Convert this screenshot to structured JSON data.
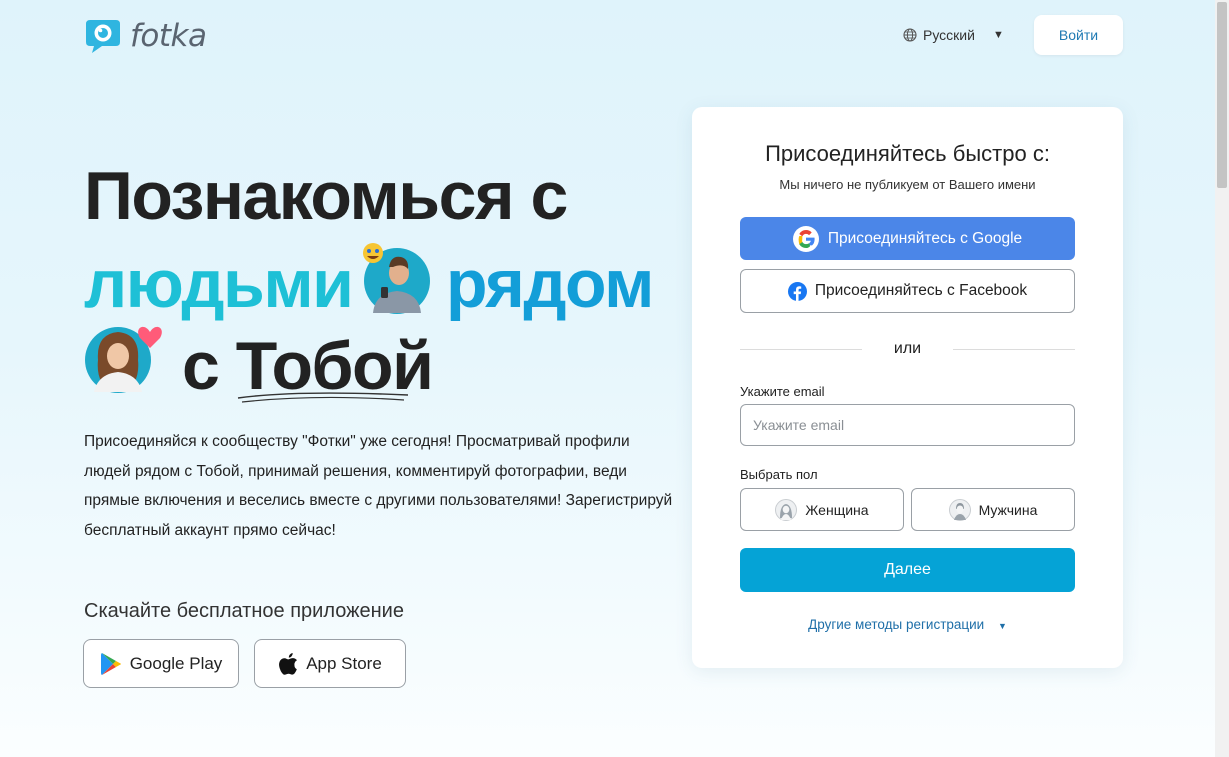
{
  "brand": {
    "name": "fotka",
    "accent": "#1fb5d6",
    "logo_color": "#2fb5e0"
  },
  "header": {
    "language": {
      "icon": "globe-icon",
      "label": "Русский",
      "caret": "▼"
    },
    "login_label": "Войти"
  },
  "hero": {
    "line1": "Познакомься с",
    "line2_word1": "людьми",
    "line2_word2": "рядом",
    "line3_prefix": "с",
    "line3_word": "Тобой",
    "description": "Присоединяйся к сообществу \"Фотки\" уже сегодня! Просматривай профили людей рядом с Тобой, принимай решения, комментируй фотографии, веди прямые включения и веселись вместе с другими пользователями! Зарегистрируй бесплатный аккаунт прямо сейчас!"
  },
  "download": {
    "title": "Скачайте бесплатное приложение",
    "google_play": "Google Play",
    "app_store": "App Store"
  },
  "signup": {
    "title": "Присоединяйтесь быстро с:",
    "subtitle": "Мы ничего не публикуем от Вашего имени",
    "google_label": "Присоединяйтесь с Google",
    "facebook_label": "Присоединяйтесь с Facebook",
    "or_label": "или",
    "email_label": "Укажите email",
    "email_placeholder": "Укажите email",
    "email_value": "",
    "gender_label": "Выбрать пол",
    "female_label": "Женщина",
    "male_label": "Мужчина",
    "next_label": "Далее",
    "other_methods_label": "Другие методы регистрации",
    "other_methods_caret": "▼",
    "colors": {
      "google_button": "#4b86e8",
      "next_button": "#05a3d6",
      "link": "#1f6fa8"
    }
  }
}
